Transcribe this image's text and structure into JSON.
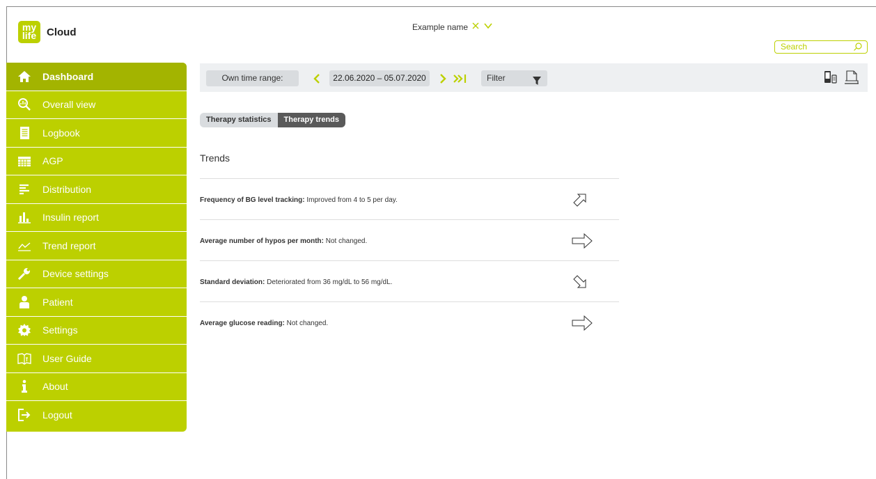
{
  "brand": {
    "badge_top": "my",
    "badge_bottom": "life",
    "name": "Cloud"
  },
  "user": {
    "name": "Example name"
  },
  "search": {
    "placeholder": "Search"
  },
  "sidebar": {
    "items": [
      {
        "label": "Dashboard",
        "icon": "home-icon",
        "active": true
      },
      {
        "label": "Overall view",
        "icon": "magnifier-chart-icon"
      },
      {
        "label": "Logbook",
        "icon": "logbook-icon"
      },
      {
        "label": "AGP",
        "icon": "calendar-icon"
      },
      {
        "label": "Distribution",
        "icon": "distribution-icon"
      },
      {
        "label": "Insulin report",
        "icon": "bar-chart-icon"
      },
      {
        "label": "Trend report",
        "icon": "trend-line-icon"
      },
      {
        "label": "Device settings",
        "icon": "wrench-icon"
      },
      {
        "label": "Patient",
        "icon": "person-icon"
      },
      {
        "label": "Settings",
        "icon": "gear-icon"
      },
      {
        "label": "User Guide",
        "icon": "book-icon"
      },
      {
        "label": "About",
        "icon": "info-icon"
      },
      {
        "label": "Logout",
        "icon": "logout-icon"
      }
    ]
  },
  "toolbar": {
    "range_label": "Own time range:",
    "date_range": "22.06.2020 – 05.07.2020",
    "filter_label": "Filter"
  },
  "tabs": [
    {
      "label": "Therapy statistics",
      "active": false
    },
    {
      "label": "Therapy trends",
      "active": true
    }
  ],
  "section_title": "Trends",
  "trends": [
    {
      "label": "Frequency of BG level tracking:",
      "text": " Improved from 4 to 5 per day.",
      "direction": "up-right"
    },
    {
      "label": "Average number of hypos per month:",
      "text": " Not changed.",
      "direction": "right"
    },
    {
      "label": "Standard deviation:",
      "text": " Deteriorated from 36 mg/dL to 56 mg/dL.",
      "direction": "down-right"
    },
    {
      "label": "Average glucose reading:",
      "text": " Not changed.",
      "direction": "right"
    }
  ],
  "colors": {
    "accent": "#bcd000",
    "accent_dark": "#a3b400",
    "toolbar_bg": "#eef0f2"
  }
}
